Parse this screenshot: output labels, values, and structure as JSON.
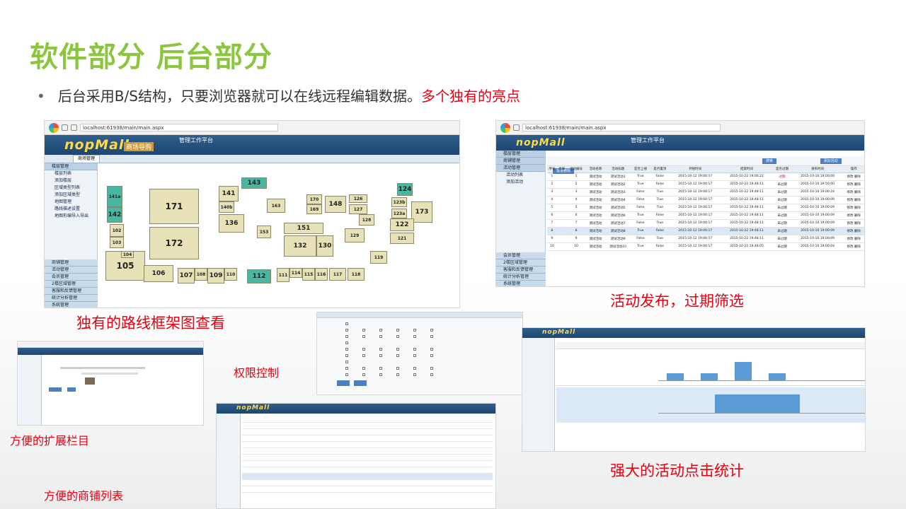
{
  "title": "软件部分 后台部分",
  "bullet": {
    "main": "后台采用B/S结构，只要浏览器就可以在线远程编辑数据。",
    "highlight": "多个独有的亮点"
  },
  "captions": {
    "map": "独有的路线框架图查看",
    "activity": "活动发布，过期筛选",
    "permission": "权限控制",
    "extension": "方便的扩展栏目",
    "stats": "强大的活动点击统计",
    "shops": "方便的商铺列表"
  },
  "app": {
    "logo": "nopMall",
    "logo_sub": "商场导购",
    "header_center": "管理工作平台",
    "tab": "商场管理",
    "url": "localhost:61938/main/main.aspx"
  },
  "map_sidebar": {
    "top_head": "楼层管理",
    "top_items": [
      "楼层列表",
      "添加楼层",
      "区域类型列表",
      "添加区域类型",
      "地图管理",
      "路线描述设置",
      "地图形编导入导出"
    ],
    "bottom_items": [
      "商铺管理",
      "活动管理",
      "会员管理",
      "2楼区域管理",
      "客服和反馈管理",
      "统计分析管理",
      "系统管理"
    ]
  },
  "map_rooms": [
    "141a",
    "142",
    "143",
    "124",
    "171",
    "141",
    "140b",
    "136",
    "163",
    "170",
    "169",
    "148",
    "126",
    "127",
    "123b",
    "123a",
    "173",
    "172",
    "153",
    "151",
    "132",
    "130",
    "129",
    "128",
    "122",
    "121",
    "105",
    "106",
    "107",
    "108",
    "109",
    "110",
    "112",
    "111",
    "114",
    "115",
    "116",
    "117",
    "118",
    "119",
    "102",
    "103",
    "104"
  ],
  "activity": {
    "headers": [
      "序号",
      "选择",
      "活动编号",
      "活动名称",
      "活动标题",
      "是否上线",
      "是否置顶",
      "开始时间",
      "结束时间",
      "是否过期",
      "发布时间",
      "操作"
    ],
    "rows": [
      [
        "1",
        "",
        "1",
        "测试活动",
        "测试活动1",
        "True",
        "False",
        "2015-10-12 19:00:17",
        "2015-10-22 19:00:22",
        "过期",
        "2015-10-10 19:00:00",
        "修改 删除"
      ],
      [
        "2",
        "",
        "2",
        "测试活动",
        "测试活动2",
        "True",
        "False",
        "2015-10-12 19:00:17",
        "2015-10-22 19:48:11",
        "未过期",
        "2015-10-10 19:50:00",
        "修改 删除"
      ],
      [
        "3",
        "",
        "3",
        "测试活动",
        "测试活动3",
        "False",
        "True",
        "2015-10-12 19:00:17",
        "2015-10-22 19:48:11",
        "未过期",
        "2015-10-10 19:00:24",
        "修改 删除"
      ],
      [
        "4",
        "",
        "4",
        "测试活动",
        "测试活动4",
        "False",
        "True",
        "2015-10-12 19:00:17",
        "2015-10-22 19:48:11",
        "未过期",
        "2015-10-10 19:00:09",
        "修改 删除"
      ],
      [
        "5",
        "",
        "5",
        "测试活动",
        "测试活动5",
        "False",
        "True",
        "2015-10-12 19:00:17",
        "2015-10-22 19:48:11",
        "未过期",
        "2015-10-10 19:00:09",
        "修改 删除"
      ],
      [
        "6",
        "",
        "6",
        "测试活动",
        "测试活动6",
        "True",
        "False",
        "2015-10-12 19:00:17",
        "2015-10-22 19:48:11",
        "未过期",
        "2015-10-10 19:00:09",
        "修改 删除"
      ],
      [
        "7",
        "",
        "7",
        "测试活动",
        "测试活动7",
        "False",
        "True",
        "2015-10-12 19:00:17",
        "2015-10-22 19:48:11",
        "未过期",
        "2015-10-10 19:00:09",
        "修改 删除"
      ],
      [
        "8",
        "",
        "8",
        "测试活动",
        "测试活动8",
        "True",
        "False",
        "2015-10-12 19:00:17",
        "2015-10-22 19:48:11",
        "未过期",
        "2015-10-10 19:00:09",
        "修改 删除"
      ],
      [
        "9",
        "",
        "9",
        "测试活动",
        "测试活动9",
        "False",
        "True",
        "2015-10-12 19:00:17",
        "2015-10-22 19:48:11",
        "未过期",
        "2015-10-10 19:00:09",
        "修改 删除"
      ],
      [
        "10",
        "",
        "10",
        "测试活动",
        "测试活动10",
        "True",
        "False",
        "2015-10-12 19:00:17",
        "2015-10-22 19:48:05",
        "未过期",
        "2015-10-10 19:00:04",
        "修改 删除"
      ]
    ],
    "sidebar_items": [
      "楼层管理",
      "商铺管理",
      "活动管理",
      "活动列表",
      "添加活动"
    ],
    "sidebar_bottom": [
      "会员管理",
      "2楼区域管理",
      "客服和反馈管理",
      "统计分析管理",
      "系统管理"
    ],
    "search_btn": "搜索",
    "add_btn": "添加活动",
    "del_btn": "批量删除"
  },
  "stats_chart": {
    "values": [
      2,
      2,
      5,
      2
    ]
  }
}
